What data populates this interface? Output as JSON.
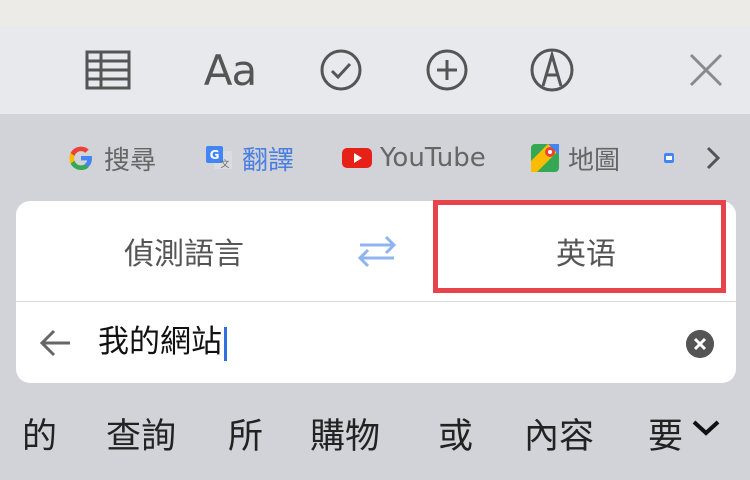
{
  "toolbar": {
    "tools": [
      {
        "name": "table-icon"
      },
      {
        "name": "format-text-icon",
        "label": "Aa"
      },
      {
        "name": "checklist-icon"
      },
      {
        "name": "add-icon"
      },
      {
        "name": "markup-pen-icon"
      },
      {
        "name": "close-icon"
      }
    ]
  },
  "shortcuts": [
    {
      "icon": "google-g-icon",
      "label": "搜尋"
    },
    {
      "icon": "google-translate-icon",
      "label": "翻譯",
      "active": true
    },
    {
      "icon": "youtube-icon",
      "label": "YouTube"
    },
    {
      "icon": "google-maps-icon",
      "label": "地圖"
    },
    {
      "icon": "small-app-icon",
      "label": ""
    },
    {
      "icon": "chevron-right-icon"
    }
  ],
  "translate": {
    "source_language": "偵測語言",
    "target_language": "英语",
    "query": "我的網站"
  },
  "suggestions": [
    "的",
    "查詢",
    "所",
    "購物",
    "或",
    "內容",
    "要"
  ],
  "colors": {
    "accent": "#4a7fe0",
    "highlight": "#e8434a",
    "youtube": "#e62117"
  }
}
